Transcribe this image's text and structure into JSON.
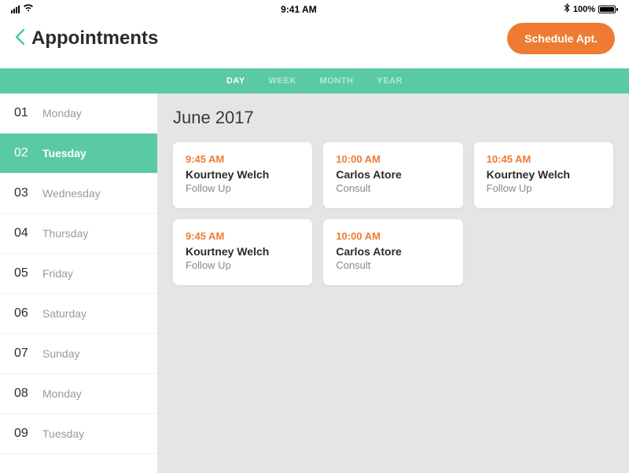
{
  "status": {
    "time": "9:41 AM",
    "battery": "100%",
    "bluetooth": "✱"
  },
  "header": {
    "title": "Appointments",
    "schedule_label": "Schedule Apt."
  },
  "tabs": {
    "day": "DAY",
    "week": "WEEK",
    "month": "MONTH",
    "year": "YEAR"
  },
  "month_title": "June 2017",
  "days": [
    {
      "num": "01",
      "name": "Monday"
    },
    {
      "num": "02",
      "name": "Tuesday"
    },
    {
      "num": "03",
      "name": "Wednesday"
    },
    {
      "num": "04",
      "name": "Thursday"
    },
    {
      "num": "05",
      "name": "Friday"
    },
    {
      "num": "06",
      "name": "Saturday"
    },
    {
      "num": "07",
      "name": "Sunday"
    },
    {
      "num": "08",
      "name": "Monday"
    },
    {
      "num": "09",
      "name": "Tuesday"
    }
  ],
  "active_day_index": 1,
  "appointments": [
    {
      "time": "9:45 AM",
      "name": "Kourtney Welch",
      "type": "Follow Up"
    },
    {
      "time": "10:00 AM",
      "name": "Carlos Atore",
      "type": "Consult"
    },
    {
      "time": "10:45 AM",
      "name": "Kourtney Welch",
      "type": "Follow Up"
    },
    {
      "time": "9:45 AM",
      "name": "Kourtney Welch",
      "type": "Follow Up"
    },
    {
      "time": "10:00 AM",
      "name": "Carlos Atore",
      "type": "Consult"
    }
  ]
}
